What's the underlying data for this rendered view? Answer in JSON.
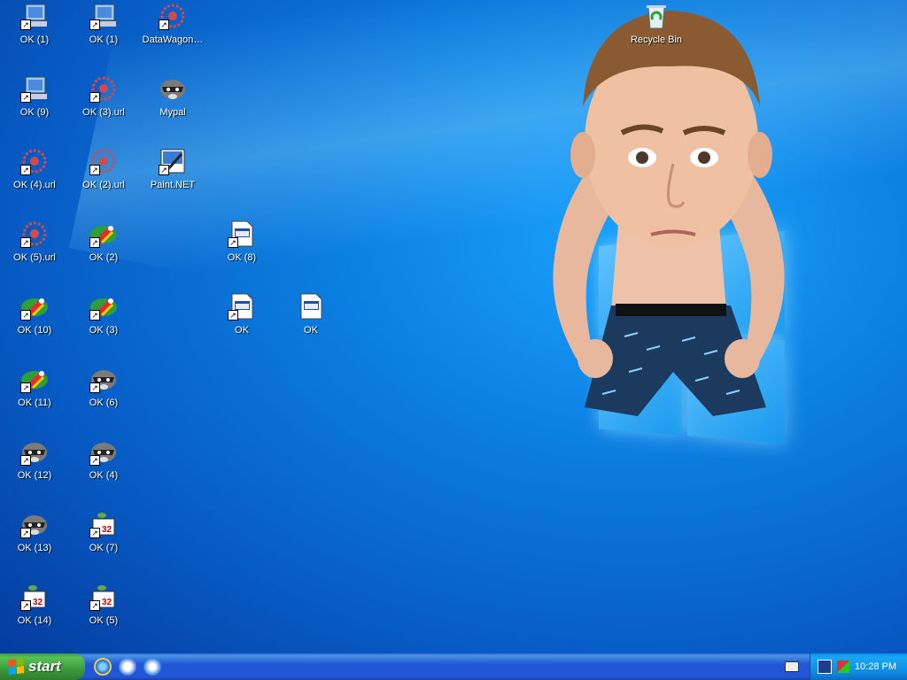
{
  "desktop": {
    "icons": [
      {
        "label": "OK (1)",
        "type": "computer"
      },
      {
        "label": "OK (9)",
        "type": "computer"
      },
      {
        "label": "OK (4).url",
        "type": "web-shortcut"
      },
      {
        "label": "OK (5).url",
        "type": "web-shortcut"
      },
      {
        "label": "OK (10)",
        "type": "parrot"
      },
      {
        "label": "OK (11)",
        "type": "parrot"
      },
      {
        "label": "OK (12)",
        "type": "raccoon"
      },
      {
        "label": "OK (13)",
        "type": "raccoon"
      },
      {
        "label": "OK (14)",
        "type": "setup32"
      },
      {
        "label": "OK (1)",
        "type": "computer"
      },
      {
        "label": "OK (3).url",
        "type": "web-shortcut"
      },
      {
        "label": "OK (2).url",
        "type": "web-shortcut"
      },
      {
        "label": "OK (2)",
        "type": "parrot"
      },
      {
        "label": "OK (3)",
        "type": "parrot"
      },
      {
        "label": "OK (6)",
        "type": "raccoon"
      },
      {
        "label": "OK (4)",
        "type": "raccoon"
      },
      {
        "label": "OK (7)",
        "type": "setup32"
      },
      {
        "label": "OK (5)",
        "type": "setup32"
      },
      {
        "label": "DataWagon…",
        "type": "web-shortcut"
      },
      {
        "label": "Mypal",
        "type": "raccoon"
      },
      {
        "label": "Paint.NET",
        "type": "paint"
      },
      {
        "label": "OK (8)",
        "type": "document"
      },
      {
        "label": "OK",
        "type": "document"
      },
      {
        "label": "OK",
        "type": "document-plain"
      },
      {
        "label": "Recycle Bin",
        "type": "recycle-bin"
      }
    ]
  },
  "taskbar": {
    "start_label": "start",
    "clock": "10:28 PM",
    "quick_launch": [
      "internet-explorer-icon",
      "email-icon",
      "media-player-icon"
    ]
  },
  "colors": {
    "desktop": "#0b7de0",
    "taskbar": "#2157d7",
    "start": "#3c9a3c",
    "tray": "#0c8be3"
  }
}
